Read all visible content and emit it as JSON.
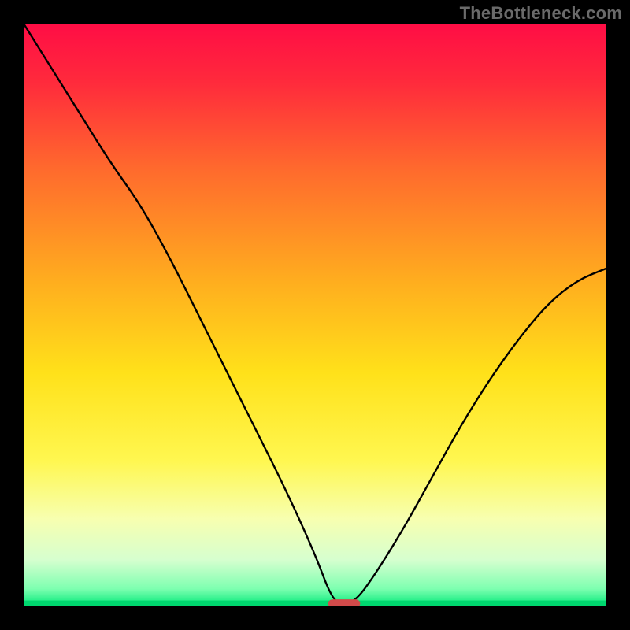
{
  "watermark": "TheBottleneck.com",
  "chart_data": {
    "type": "line",
    "title": "",
    "xlabel": "",
    "ylabel": "",
    "xlim": [
      0,
      100
    ],
    "ylim": [
      0,
      100
    ],
    "x": [
      0,
      5,
      10,
      15,
      20,
      25,
      30,
      35,
      40,
      45,
      50,
      53,
      55,
      57,
      60,
      65,
      70,
      75,
      80,
      85,
      90,
      95,
      100
    ],
    "values": [
      100,
      92,
      84,
      76,
      69,
      60,
      50,
      40,
      30,
      20,
      9,
      1,
      0.5,
      1,
      5,
      13,
      22,
      31,
      39,
      46,
      52,
      56,
      58
    ],
    "optimal_x": 55,
    "marker": {
      "x": 55,
      "y": 0.5,
      "width_pct": 5.5,
      "height_pct": 1.4,
      "color": "#d14a4a"
    },
    "gradient_stops": [
      {
        "offset": 0,
        "color": "#ff0d45"
      },
      {
        "offset": 10,
        "color": "#ff2a3c"
      },
      {
        "offset": 25,
        "color": "#ff6a2d"
      },
      {
        "offset": 45,
        "color": "#ffb01e"
      },
      {
        "offset": 60,
        "color": "#ffe11a"
      },
      {
        "offset": 75,
        "color": "#fff750"
      },
      {
        "offset": 85,
        "color": "#f7ffb0"
      },
      {
        "offset": 92,
        "color": "#d6ffcf"
      },
      {
        "offset": 97,
        "color": "#7dffb0"
      },
      {
        "offset": 100,
        "color": "#00e878"
      }
    ],
    "baseline_band": {
      "color": "#00d86f",
      "height_pct": 1.0
    }
  }
}
